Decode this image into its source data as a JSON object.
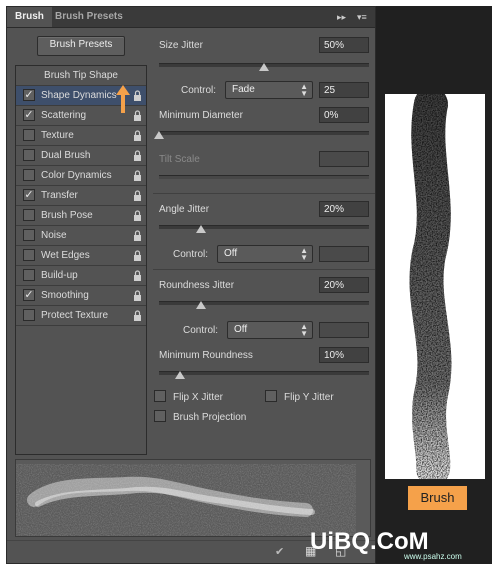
{
  "tabs": [
    {
      "label": "Brush"
    },
    {
      "label": "Brush Presets"
    }
  ],
  "tab_controls": {
    "collapse": "▸▸",
    "menu": "▾≡"
  },
  "brush_presets_button": "Brush Presets",
  "left_list": {
    "header": "Brush Tip Shape",
    "items": [
      {
        "label": "Shape Dynamics",
        "checked": true,
        "selected": true
      },
      {
        "label": "Scattering",
        "checked": true
      },
      {
        "label": "Texture",
        "checked": false
      },
      {
        "label": "Dual Brush",
        "checked": false
      },
      {
        "label": "Color Dynamics",
        "checked": false
      },
      {
        "label": "Transfer",
        "checked": true
      },
      {
        "label": "Brush Pose",
        "checked": false
      },
      {
        "label": "Noise",
        "checked": false
      },
      {
        "label": "Wet Edges",
        "checked": false
      },
      {
        "label": "Build-up",
        "checked": false
      },
      {
        "label": "Smoothing",
        "checked": true
      },
      {
        "label": "Protect Texture",
        "checked": false
      }
    ],
    "check_glyph": "✓",
    "lock_glyph": "🔒"
  },
  "settings": {
    "size_jitter": {
      "label": "Size Jitter",
      "value": "50%",
      "level": 0.5
    },
    "size_control": {
      "label": "Control:",
      "value": "Fade",
      "steps": "25"
    },
    "min_diameter": {
      "label": "Minimum Diameter",
      "value": "0%",
      "level": 0
    },
    "tilt_scale": {
      "label": "Tilt Scale",
      "value": ""
    },
    "angle_jitter": {
      "label": "Angle Jitter",
      "value": "20%",
      "level": 0.2
    },
    "angle_control": {
      "label": "Control:",
      "value": "Off"
    },
    "roundness_jitter": {
      "label": "Roundness Jitter",
      "value": "20%",
      "level": 0.2
    },
    "roundness_control": {
      "label": "Control:",
      "value": "Off"
    },
    "min_roundness": {
      "label": "Minimum Roundness",
      "value": "10%",
      "level": 0.1
    },
    "flip_x": {
      "label": "Flip X Jitter",
      "checked": false
    },
    "flip_y": {
      "label": "Flip Y Jitter",
      "checked": false
    },
    "brush_projection": {
      "label": "Brush Projection",
      "checked": false
    }
  },
  "annotation_arrow": {
    "color": "#f5a14a"
  },
  "canvas_label": "Brush",
  "watermark": {
    "main": "UiBQ.CoM",
    "sub": "www.psahz.com"
  },
  "colors": {
    "accent": "#f5a14a",
    "panel": "#535353",
    "selected": "#3e4f6b"
  }
}
